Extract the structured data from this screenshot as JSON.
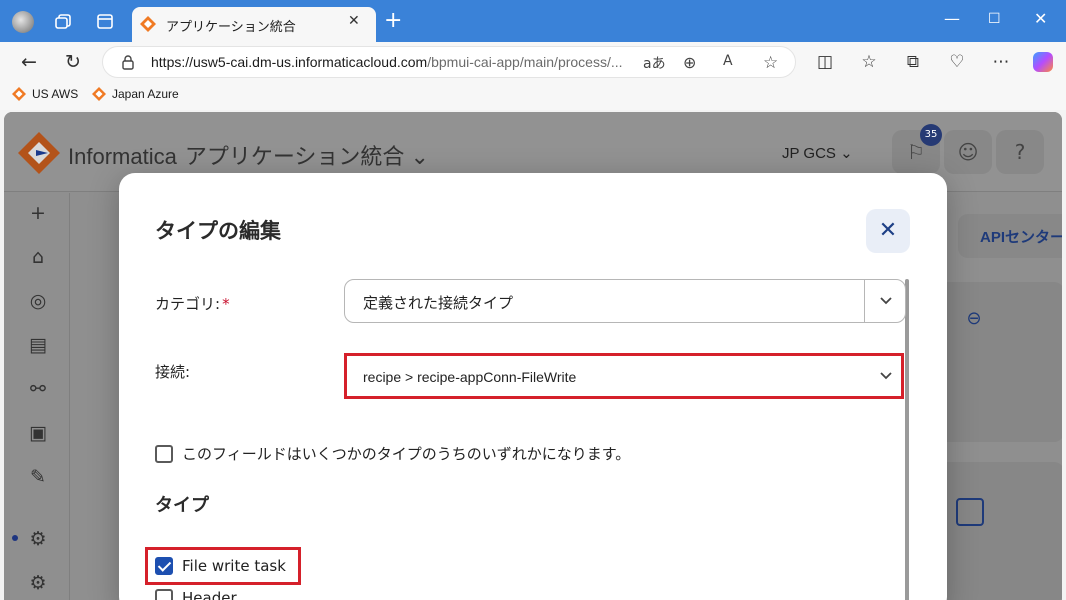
{
  "browser": {
    "tab_title": "アプリケーション統合",
    "tab_close": "✕",
    "new_tab": "+",
    "url_host": "https://usw5-cai.dm-us.informaticacloud.com",
    "url_path": "/bpmui-cai-app/main/process/...",
    "read_aloud_label": "aあ",
    "window_controls": {
      "minimize": "—",
      "maximize": "☐",
      "close": "✕"
    },
    "bookmarks": [
      {
        "label": "US AWS"
      },
      {
        "label": "Japan Azure"
      }
    ]
  },
  "app": {
    "brand": "Informatica",
    "service": "アプリケーション統合",
    "org": "JP GCS",
    "notification_count": "35",
    "help_label": "?",
    "api_center_tab": "APIセンター"
  },
  "modal": {
    "title": "タイプの編集",
    "close_label": "✕",
    "category": {
      "label": "カテゴリ:",
      "required": "*",
      "value": "定義された接続タイプ"
    },
    "connection": {
      "label": "接続:",
      "value": "recipe > recipe-appConn-FileWrite"
    },
    "one_of_types": {
      "label": "このフィールドはいくつかのタイプのうちのいずれかになります。",
      "checked": false
    },
    "types_title": "タイプ",
    "types": [
      {
        "label": "File write task",
        "checked": true
      },
      {
        "label": "Header",
        "checked": false
      }
    ]
  },
  "colors": {
    "accent": "#1d4fb0",
    "highlight": "#d5202a",
    "titlebar": "#3a82d8"
  }
}
